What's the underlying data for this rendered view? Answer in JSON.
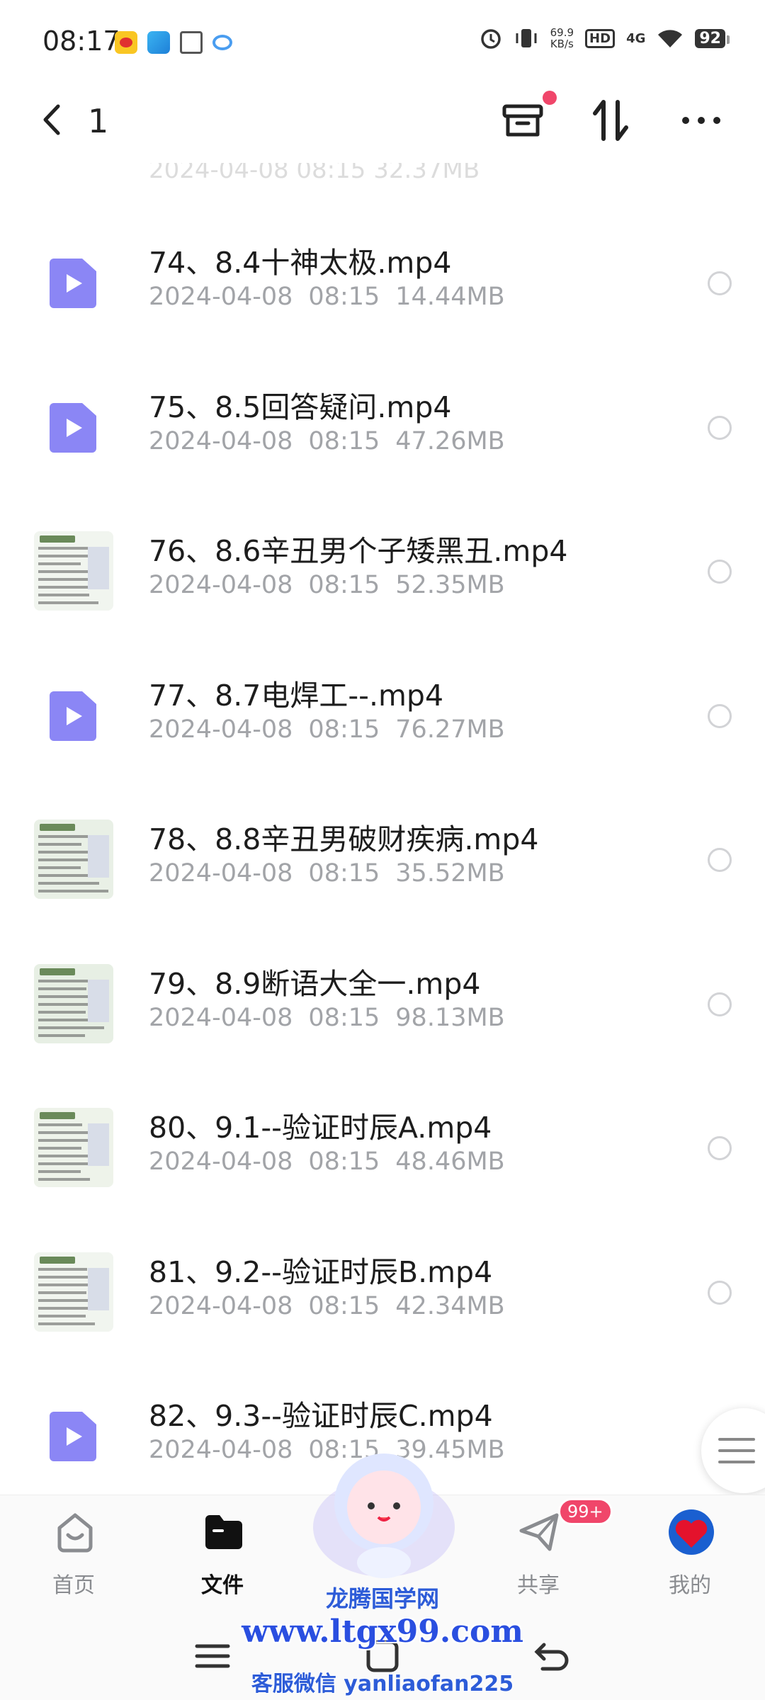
{
  "status_bar": {
    "time": "08:17",
    "net_speed_value": "69.9",
    "net_speed_unit": "KB/s",
    "hd": "HD",
    "network": "4G",
    "battery": "92",
    "app_icons": [
      "weibo-icon",
      "telegram-icon",
      "gift-icon",
      "cloud-app-icon"
    ],
    "right_icons": [
      "alarm-icon",
      "vibrate-icon",
      "wifi-icon"
    ]
  },
  "header": {
    "title": "1",
    "icons": [
      "back-icon",
      "archive-icon",
      "sort-icon",
      "more-icon"
    ],
    "accent": "#f0466a"
  },
  "list": {
    "partial_top": "2024-04-08 08:15 32.37MB",
    "items": [
      {
        "name": "74、8.4十神太极.mp4",
        "date": "2024-04-08",
        "time": "08:15",
        "size": "14.44MB",
        "thumb": "video"
      },
      {
        "name": "75、8.5回答疑问.mp4",
        "date": "2024-04-08",
        "time": "08:15",
        "size": "47.26MB",
        "thumb": "video"
      },
      {
        "name": "76、8.6辛丑男个子矮黑丑.mp4",
        "date": "2024-04-08",
        "time": "08:15",
        "size": "52.35MB",
        "thumb": "image"
      },
      {
        "name": "77、8.7电焊工--.mp4",
        "date": "2024-04-08",
        "time": "08:15",
        "size": "76.27MB",
        "thumb": "video"
      },
      {
        "name": "78、8.8辛丑男破财疾病.mp4",
        "date": "2024-04-08",
        "time": "08:15",
        "size": "35.52MB",
        "thumb": "image"
      },
      {
        "name": "79、8.9断语大全一.mp4",
        "date": "2024-04-08",
        "time": "08:15",
        "size": "98.13MB",
        "thumb": "image"
      },
      {
        "name": "80、9.1--验证时辰A.mp4",
        "date": "2024-04-08",
        "time": "08:15",
        "size": "48.46MB",
        "thumb": "image"
      },
      {
        "name": "81、9.2--验证时辰B.mp4",
        "date": "2024-04-08",
        "time": "08:15",
        "size": "42.34MB",
        "thumb": "image"
      },
      {
        "name": "82、9.3--验证时辰C.mp4",
        "date": "2024-04-08",
        "time": "08:15",
        "size": "39.45MB",
        "thumb": "video"
      }
    ],
    "video_icon_color": "#8b86f5"
  },
  "tabs": [
    {
      "label": "首页",
      "icon": "home-icon",
      "active": false
    },
    {
      "label": "文件",
      "icon": "folder-icon",
      "active": true
    },
    {
      "label": "共享",
      "icon": "share-icon",
      "active": false,
      "badge": "99+"
    },
    {
      "label": "我的",
      "icon": "avatar",
      "active": false
    }
  ],
  "nav_bar": {
    "icons": [
      "menu-icon",
      "home-nav-icon",
      "back-nav-icon"
    ]
  },
  "watermark": {
    "title": "龙腾国学网",
    "url": "www.ltgx99.com",
    "contact": "客服微信 yanliaofan225"
  }
}
